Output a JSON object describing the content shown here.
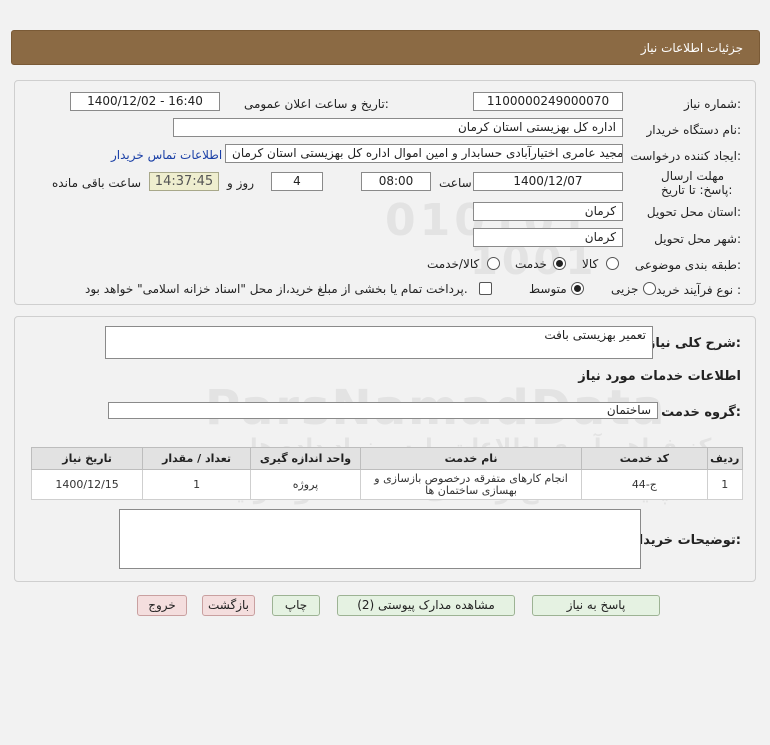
{
  "header": {
    "title": "جزئیات اطلاعات نیاز"
  },
  "form": {
    "need_number_label": "شماره نیاز:",
    "need_number": "1100000249000070",
    "announce_label": "تاریخ و ساعت اعلان عمومی:",
    "announce_value": "1400/12/02 - 16:40",
    "buyer_org_label": "نام دستگاه خریدار:",
    "buyer_org": "اداره کل بهزیستی استان کرمان",
    "requester_label": "ایجاد کننده درخواست:",
    "requester": "مجید عامری اختیارآبادی حسابدار و امین اموال اداره کل بهزیستی استان کرمان",
    "contact_link": "اطلاعات تماس خریدار",
    "deadline_label": "مهلت ارسال پاسخ: تا تاریخ:",
    "deadline_date": "1400/12/07",
    "time_label": "ساعت",
    "deadline_time": "08:00",
    "days": "4",
    "days_label": "روز و",
    "remaining_time": "14:37:45",
    "remaining_label": "ساعت باقی مانده",
    "province_label": "استان محل تحویل:",
    "province": "کرمان",
    "city_label": "شهر محل تحویل:",
    "city": "کرمان",
    "category_label": "طبقه بندی موضوعی:",
    "category_options": [
      "کالا",
      "خدمت",
      "کالا/خدمت"
    ],
    "category_selected": "خدمت",
    "process_label": "نوع فرآیند خرید :",
    "process_options": [
      "جزیی",
      "متوسط"
    ],
    "process_selected": "متوسط",
    "payment_note": "پرداخت تمام یا بخشی از مبلغ خرید،از محل \"اسناد خزانه اسلامی\" خواهد بود."
  },
  "details": {
    "summary_label": "شرح کلی نیاز:",
    "summary": "تعمیر بهزیستی بافت",
    "services_title": "اطلاعات خدمات مورد نیاز",
    "group_label": "گروه خدمت:",
    "group": "ساختمان",
    "table": {
      "headers": [
        "ردیف",
        "کد خدمت",
        "نام خدمت",
        "واحد اندازه گیری",
        "تعداد / مقدار",
        "تاریخ نیاز"
      ],
      "rows": [
        [
          "1",
          "ج-44",
          "انجام کارهای متفرقه درخصوص بازسازی و بهسازی ساختمان ها",
          "پروژه",
          "1",
          "1400/12/15"
        ]
      ]
    },
    "buyer_notes_label": "توضیحات خریدار:"
  },
  "buttons": {
    "reply": "پاسخ به نیاز",
    "attachments": "مشاهده مدارک پیوستی (2)",
    "print": "چاپ",
    "back": "بازگشت",
    "exit": "خروج"
  },
  "watermark": {
    "digits_1": "010101",
    "digits_2": "1001",
    "brand": "ParsNamadData",
    "line_1": "مرکز فراهم آوری اطلاعات پارس نماد داده ها",
    "line_2": "پایگاه اطلاع رسانی مناقصه و مزایده",
    "phone": "۰۲۱-۸۸۳۴۹۶۷۰-۵"
  }
}
